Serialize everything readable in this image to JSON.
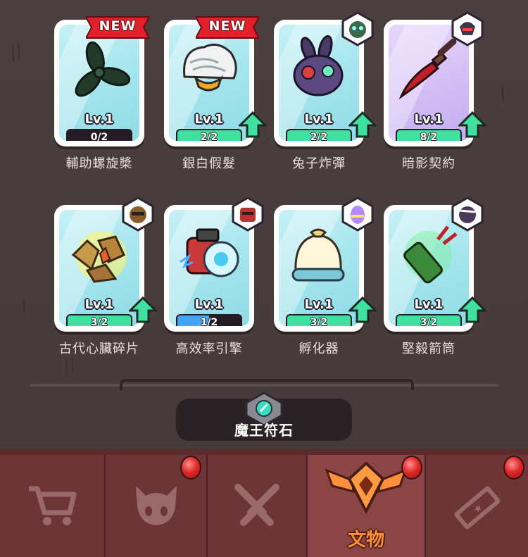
{
  "relics": [
    {
      "name": "輔助螺旋槳",
      "level": "Lv.1",
      "progress": "0/2",
      "progress_value": 0,
      "badge": "NEW",
      "upgradable": false,
      "bar_color": "green"
    },
    {
      "name": "銀白假髮",
      "level": "Lv.1",
      "progress": "2/2",
      "progress_value": 1,
      "badge": "NEW",
      "upgradable": true,
      "bar_color": "green"
    },
    {
      "name": "兔子炸彈",
      "level": "Lv.1",
      "progress": "2/2",
      "progress_value": 1,
      "badge": "avatar",
      "upgradable": true,
      "bar_color": "green"
    },
    {
      "name": "暗影契約",
      "level": "Lv.1",
      "progress": "8/2",
      "progress_value": 1,
      "badge": "avatar",
      "upgradable": true,
      "bar_color": "green"
    },
    {
      "name": "古代心臟碎片",
      "level": "Lv.1",
      "progress": "3/2",
      "progress_value": 1,
      "badge": "avatar",
      "upgradable": true,
      "bar_color": "green"
    },
    {
      "name": "高效率引擎",
      "level": "Lv.1",
      "progress": "1/2",
      "progress_value": 0.5,
      "badge": "avatar",
      "upgradable": false,
      "bar_color": "blue"
    },
    {
      "name": "孵化器",
      "level": "Lv.1",
      "progress": "3/2",
      "progress_value": 1,
      "badge": "avatar",
      "upgradable": true,
      "bar_color": "green"
    },
    {
      "name": "堅毅箭筒",
      "level": "Lv.1",
      "progress": "3/2",
      "progress_value": 1,
      "badge": "avatar",
      "upgradable": true,
      "bar_color": "green"
    }
  ],
  "rune": {
    "label": "魔王符石"
  },
  "nav": {
    "tabs": [
      {
        "icon": "cart-icon",
        "label": "",
        "notify": false
      },
      {
        "icon": "demon-face-icon",
        "label": "",
        "notify": true
      },
      {
        "icon": "crossed-swords-icon",
        "label": "",
        "notify": false
      },
      {
        "icon": "winged-emblem-icon",
        "label": "文物",
        "notify": true,
        "active": true
      },
      {
        "icon": "ticket-icon",
        "label": "",
        "notify": true
      }
    ]
  },
  "colors": {
    "accent": "#ff8f3a",
    "progress_green": "#3fe0a0",
    "progress_blue": "#47a4f3",
    "notify_red": "#e02a2a"
  }
}
